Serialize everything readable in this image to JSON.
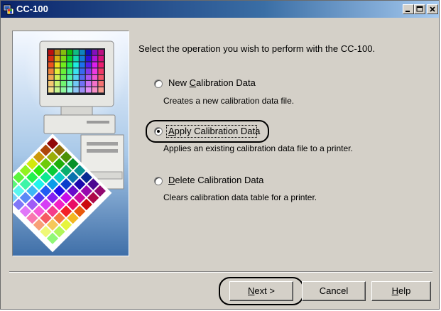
{
  "window": {
    "title": "CC-100"
  },
  "prompt": "Select the operation you wish to perform with the CC-100.",
  "options": [
    {
      "pre": "New ",
      "key": "C",
      "post": "alibration Data",
      "description": "Creates a new calibration data file.",
      "selected": false
    },
    {
      "pre": "",
      "key": "A",
      "post": "pply Calibration Data",
      "description": "Applies an existing calibration data file to a printer.",
      "selected": true
    },
    {
      "pre": "",
      "key": "D",
      "post": "elete Calibration Data",
      "description": "Clears calibration data table for a printer.",
      "selected": false
    }
  ],
  "buttons": {
    "next": {
      "key": "N",
      "rest": "ext >"
    },
    "cancel": {
      "label": "Cancel"
    },
    "help": {
      "key": "H",
      "rest": "elp"
    }
  },
  "icons": [
    "app-icon",
    "minimize-icon",
    "maximize-icon",
    "close-icon"
  ],
  "colors": {
    "titlebar_start": "#0a246a",
    "titlebar_end": "#a6caf0",
    "face": "#d4d0c8"
  }
}
